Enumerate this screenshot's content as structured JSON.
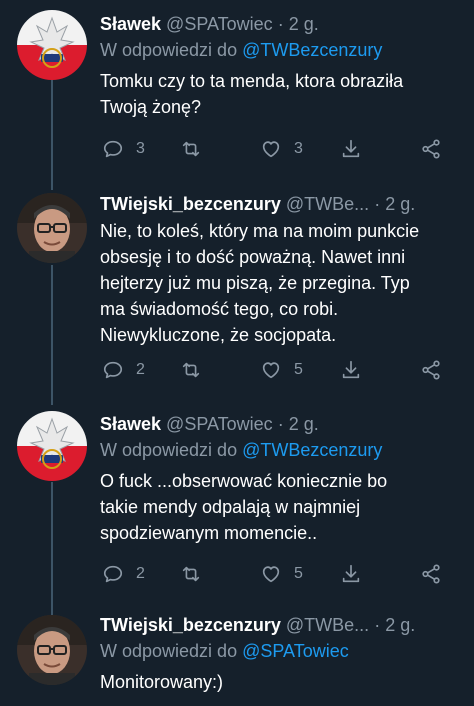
{
  "tweets": [
    {
      "name": "Sławek",
      "handle": "@SPATowiec",
      "time": "2 g.",
      "reply_prefix": "W odpowiedzi do",
      "reply_mention": "@TWBezcenzury",
      "text_lines": [
        "Tomku czy to ta menda, ktora obraziła",
        "Twoją żonę?"
      ],
      "replies": "3",
      "retweets": "",
      "likes": "3",
      "avatar": "police-logo-avatar"
    },
    {
      "name": "TWiejski_bezcenzury",
      "handle": "@TWBe...",
      "time": "2 g.",
      "reply_prefix": "",
      "reply_mention": "",
      "text_lines": [
        "Nie, to koleś, który ma na moim punkcie",
        "obsesję i to dość poważną. Nawet inni",
        "hejterzy już mu piszą, że przegina. Typ",
        "ma świadomość tego, co robi.",
        "Niewykluczone, że socjopata."
      ],
      "replies": "2",
      "retweets": "",
      "likes": "5",
      "avatar": "man-glasses-avatar"
    },
    {
      "name": "Sławek",
      "handle": "@SPATowiec",
      "time": "2 g.",
      "reply_prefix": "W odpowiedzi do",
      "reply_mention": "@TWBezcenzury",
      "text_lines": [
        "O fuck ...obserwować koniecznie bo",
        "takie mendy odpalają w najmniej",
        "spodziewanym momencie.."
      ],
      "replies": "2",
      "retweets": "",
      "likes": "5",
      "avatar": "police-logo-avatar"
    },
    {
      "name": "TWiejski_bezcenzury",
      "handle": "@TWBe...",
      "time": "2 g.",
      "reply_prefix": "W odpowiedzi do",
      "reply_mention": "@SPATowiec",
      "text_lines": [
        "Monitorowany:)"
      ],
      "avatar": "man-glasses-avatar"
    }
  ],
  "colors": {
    "background": "#15202b",
    "secondary_text": "#8b98a5",
    "accent": "#1d9bf0",
    "thread_line": "#3d5466"
  }
}
